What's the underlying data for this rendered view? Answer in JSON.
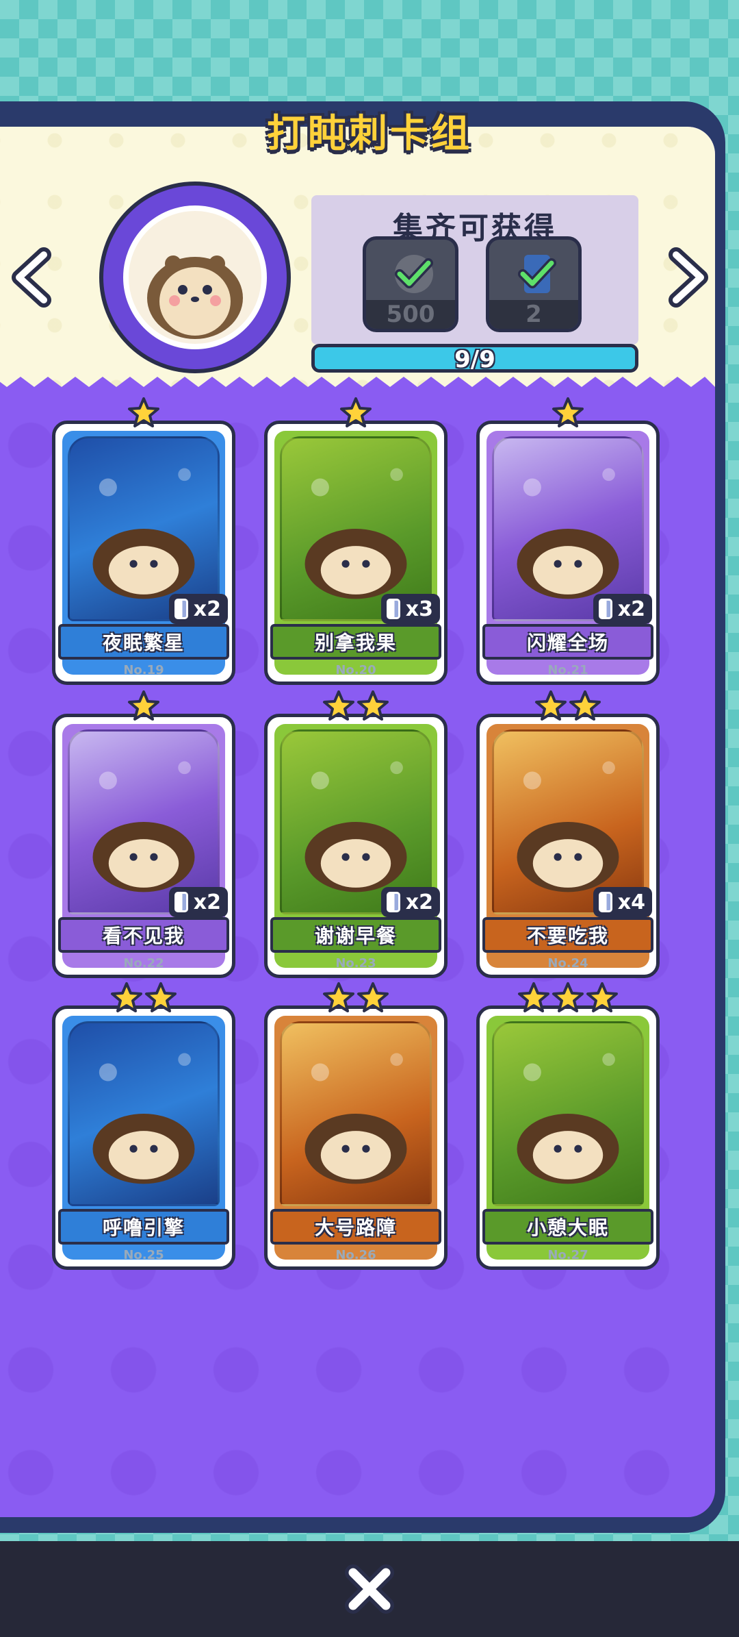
{
  "header": {
    "title": "打盹刺卡组"
  },
  "reward": {
    "title": "集齐可获得",
    "items": [
      {
        "name": "coin-pile-icon",
        "value": "500"
      },
      {
        "name": "card-pack-icon",
        "value": "2"
      }
    ],
    "progress_label": "9/9",
    "progress_fraction": 1.0
  },
  "cards": [
    {
      "name": "夜眠繁星",
      "no": "No.19",
      "stars": 1,
      "count": "x2",
      "theme": "blue"
    },
    {
      "name": "别拿我果",
      "no": "No.20",
      "stars": 1,
      "count": "x3",
      "theme": "green"
    },
    {
      "name": "闪耀全场",
      "no": "No.21",
      "stars": 1,
      "count": "x2",
      "theme": "purple"
    },
    {
      "name": "看不见我",
      "no": "No.22",
      "stars": 1,
      "count": "x2",
      "theme": "purple"
    },
    {
      "name": "谢谢早餐",
      "no": "No.23",
      "stars": 2,
      "count": "x2",
      "theme": "green"
    },
    {
      "name": "不要吃我",
      "no": "No.24",
      "stars": 2,
      "count": "x4",
      "theme": "orange"
    },
    {
      "name": "呼噜引擎",
      "no": "No.25",
      "stars": 2,
      "count": "",
      "theme": "blue"
    },
    {
      "name": "大号路障",
      "no": "No.26",
      "stars": 2,
      "count": "",
      "theme": "orange"
    },
    {
      "name": "小憩大眠",
      "no": "No.27",
      "stars": 3,
      "count": "",
      "theme": "green"
    }
  ],
  "colors": {
    "blue": "#2f7fd8",
    "green": "#5a9a2a",
    "purple": "#8a5cd8",
    "orange": "#c8641e",
    "panel_purple": "#8a5cf2",
    "title_yellow": "#ffd23a"
  }
}
